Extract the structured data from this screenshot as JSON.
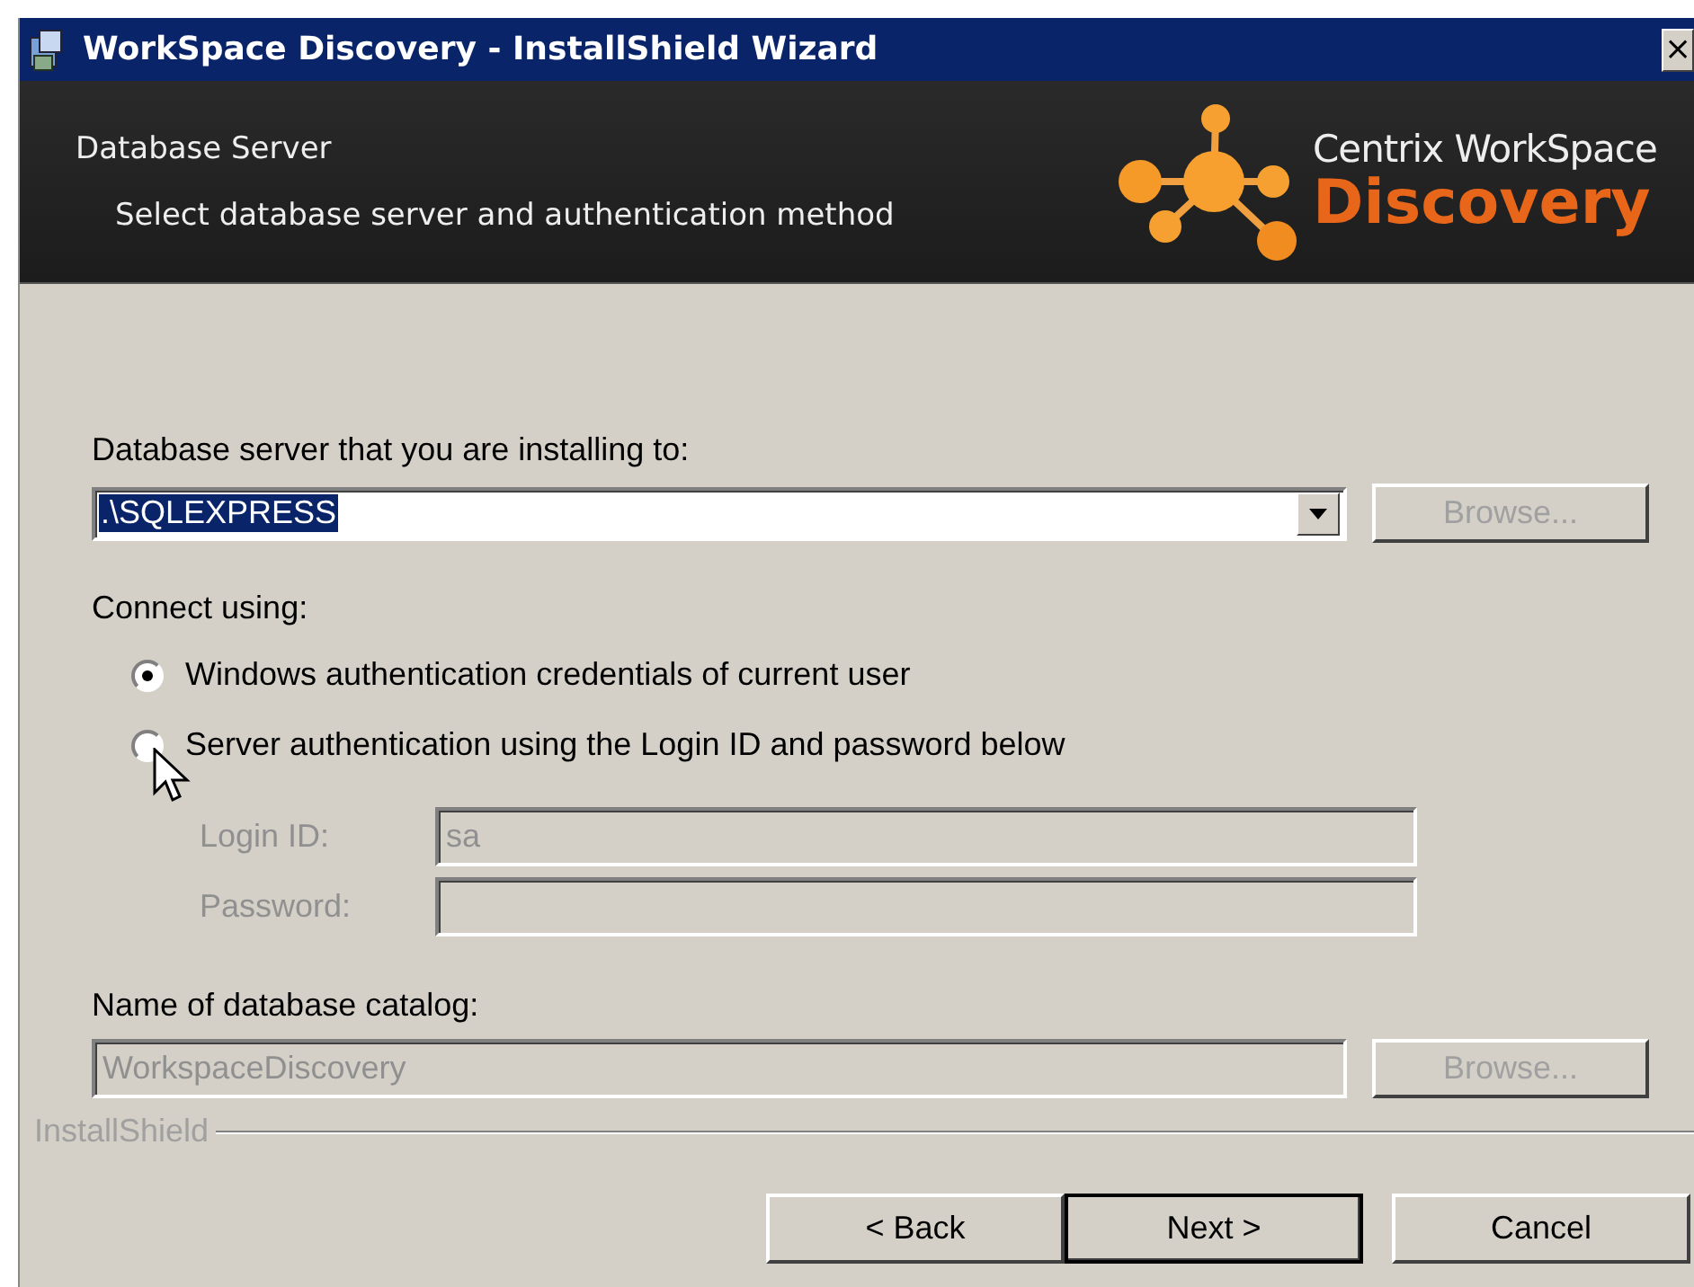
{
  "window": {
    "title": "WorkSpace Discovery - InstallShield Wizard",
    "close_label": "×"
  },
  "header": {
    "title": "Database Server",
    "subtitle": "Select database server and authentication method",
    "logo": {
      "line1": "Centrix WorkSpace",
      "line2": "Discovery"
    }
  },
  "server": {
    "label": "Database server that you are installing to:",
    "value": ".\\SQLEXPRESS",
    "value_selected": true,
    "browse": {
      "label": "Browse...",
      "disabled": true
    }
  },
  "connect": {
    "label": "Connect using:",
    "options": [
      {
        "label": "Windows authentication credentials of current user",
        "selected": true
      },
      {
        "label": "Server authentication using the Login ID and password below",
        "selected": false
      }
    ]
  },
  "credentials": [
    {
      "label": "Login ID:",
      "value": "sa",
      "disabled": true
    },
    {
      "label": "Password:",
      "disabled": true
    }
  ],
  "catalog": {
    "label": "Name of database catalog:",
    "value": "WorkspaceDiscovery",
    "disabled": true,
    "browse": {
      "label": "Browse...",
      "disabled": true
    }
  },
  "brand": "InstallShield",
  "buttons": [
    {
      "label": "< Back",
      "default": false
    },
    {
      "label": "Next >",
      "default": true
    },
    {
      "label": "Cancel",
      "default": false
    }
  ]
}
